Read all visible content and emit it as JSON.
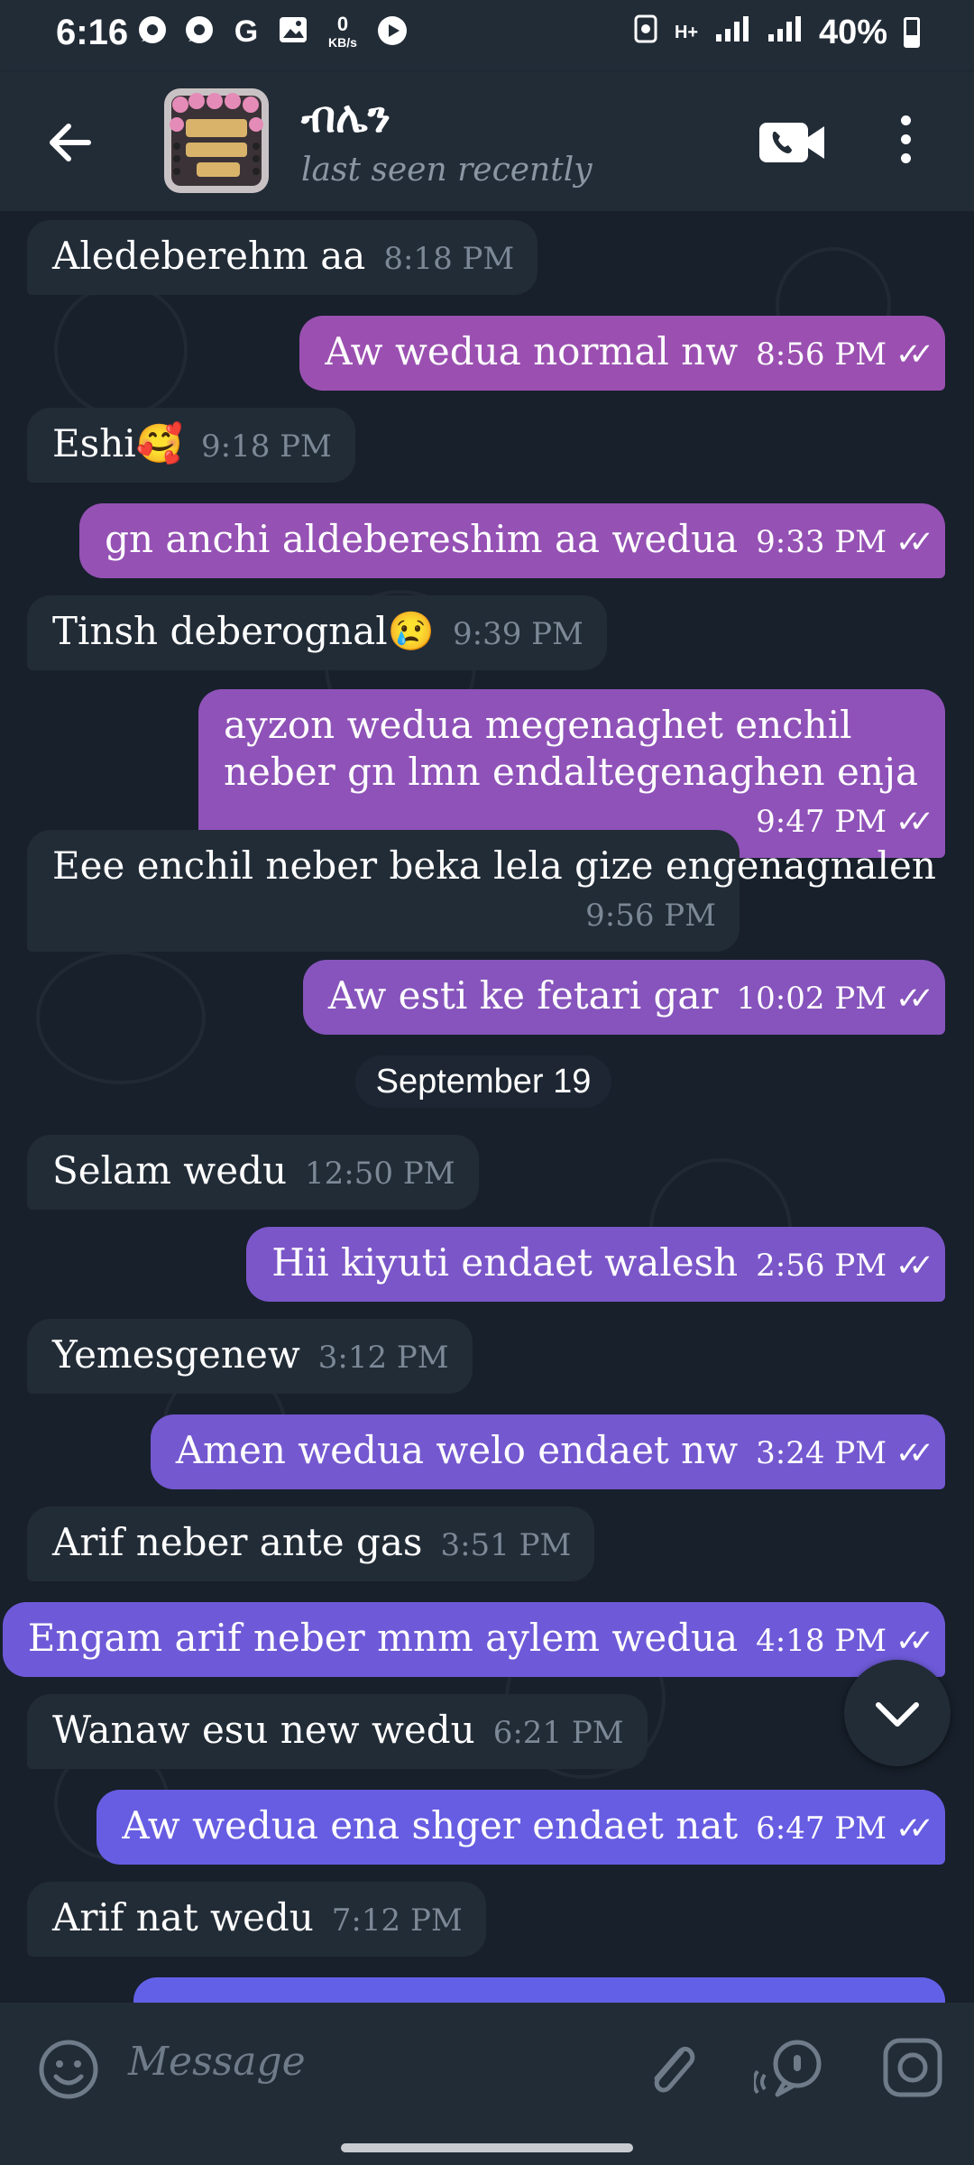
{
  "status_bar": {
    "time": "6:16",
    "net_speed_value": "0",
    "net_speed_unit": "KB/s",
    "network_type": "H+",
    "battery": "40%",
    "battery_level": 0.4
  },
  "header": {
    "contact_name": "ብሌን",
    "status": "last seen recently"
  },
  "messages": [
    {
      "direction": "in",
      "text": "Aledeberehm aa",
      "time": "8:18 PM"
    },
    {
      "direction": "out",
      "text": "Aw wedua normal nw",
      "time": "8:56 PM"
    },
    {
      "direction": "in",
      "text": "Eshi🥰",
      "time": "9:18 PM"
    },
    {
      "direction": "out",
      "text": "gn anchi aldebereshim aa wedua",
      "time": "9:33 PM"
    },
    {
      "direction": "in",
      "text": "Tinsh deberognal😢",
      "time": "9:39 PM"
    },
    {
      "direction": "out",
      "text": "ayzon wedua megenaghet enchil neber gn lmn endaltegenaghen enja",
      "time": "9:47 PM"
    },
    {
      "direction": "in",
      "text": "Eee enchil neber beka lela gize engenagnalen",
      "time": "9:56 PM"
    },
    {
      "direction": "out",
      "text": "Aw esti ke fetari gar",
      "time": "10:02 PM"
    },
    {
      "direction": "in",
      "text": "Selam wedu",
      "time": "12:50 PM"
    },
    {
      "direction": "out",
      "text": "Hii kiyuti endaet walesh",
      "time": "2:56 PM"
    },
    {
      "direction": "in",
      "text": "Yemesgenew",
      "time": "3:12 PM"
    },
    {
      "direction": "out",
      "text": "Amen wedua welo endaet nw",
      "time": "3:24 PM"
    },
    {
      "direction": "in",
      "text": "Arif neber ante gas",
      "time": "3:51 PM"
    },
    {
      "direction": "out",
      "text": "Engam arif neber mnm aylem wedua",
      "time": "4:18 PM"
    },
    {
      "direction": "in",
      "text": "Wanaw esu new wedu",
      "time": "6:21 PM"
    },
    {
      "direction": "out",
      "text": "Aw wedua ena shger endaet nat",
      "time": "6:47 PM"
    },
    {
      "direction": "in",
      "text": "Arif nat wedu",
      "time": "7:12 PM"
    }
  ],
  "date_separator": "September 19",
  "composer": {
    "placeholder": "Message"
  },
  "colors": {
    "background": "#17202b",
    "header": "#222c37",
    "incoming_bubble": "#222c37",
    "outgoing_gradient_top": "#9b4fb2",
    "outgoing_gradient_bottom": "#6a5ce8"
  }
}
